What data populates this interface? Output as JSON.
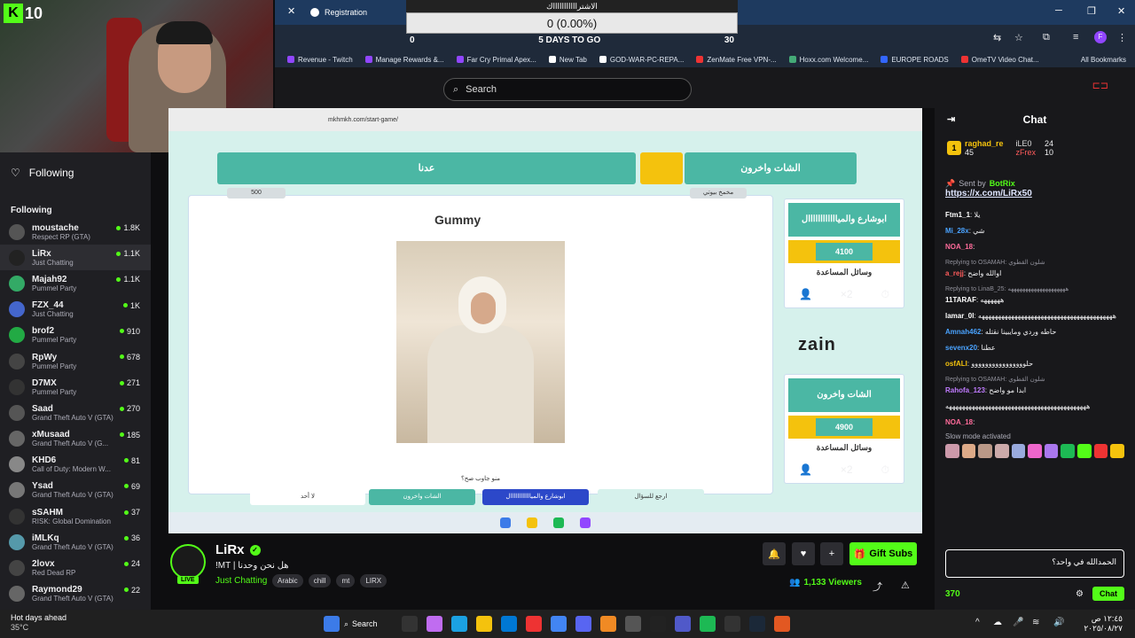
{
  "browser": {
    "tabs": [
      {
        "label": "Registration"
      }
    ],
    "bookmarks": [
      {
        "label": "Revenue - Twitch",
        "color": "#9146ff"
      },
      {
        "label": "Manage Rewards &...",
        "color": "#9146ff"
      },
      {
        "label": "Far Cry Primal Apex...",
        "color": "#9146ff"
      },
      {
        "label": "New Tab",
        "color": "#fff"
      },
      {
        "label": "GOD-WAR-PC-REPA...",
        "color": "#fff"
      },
      {
        "label": "ZenMate Free VPN-...",
        "color": "#e33"
      },
      {
        "label": "Hoxx.com Welcome...",
        "color": "#4a7"
      },
      {
        "label": "EUROPE ROADS",
        "color": "#36f"
      },
      {
        "label": "OmeTV Video Chat...",
        "color": "#e33"
      }
    ],
    "all_bookmarks": "All Bookmarks",
    "url": "mkhmkh.com/start-game/"
  },
  "goal": {
    "title": "الاشتراااااااااااك",
    "value_text": "0 (0.00%)",
    "progress": 0,
    "start": "0",
    "end": "30",
    "days": "5 DAYS TO GO"
  },
  "webcam": {
    "badge": "K",
    "count": "10"
  },
  "search": {
    "placeholder": "Search"
  },
  "sidebar": {
    "following_header": "Following",
    "section_label": "Following",
    "items": [
      {
        "name": "moustache",
        "category": "Respect RP (GTA)",
        "viewers": "1.8K",
        "color": "#555"
      },
      {
        "name": "LiRx",
        "category": "Just Chatting",
        "viewers": "1.1K",
        "color": "#222",
        "active": true
      },
      {
        "name": "Majah92",
        "category": "Pummel Party",
        "viewers": "1.1K",
        "color": "#3a6"
      },
      {
        "name": "FZX_44",
        "category": "Just Chatting",
        "viewers": "1K",
        "color": "#46c"
      },
      {
        "name": "brof2",
        "category": "Pummel Party",
        "viewers": "910",
        "color": "#2a4"
      },
      {
        "name": "RpWy",
        "category": "Pummel Party",
        "viewers": "678",
        "color": "#444"
      },
      {
        "name": "D7MX",
        "category": "Pummel Party",
        "viewers": "271",
        "color": "#333"
      },
      {
        "name": "Saad",
        "category": "Grand Theft Auto V (GTA)",
        "viewers": "270",
        "color": "#555"
      },
      {
        "name": "xMusaad",
        "category": "Grand Theft Auto V (G...",
        "viewers": "185",
        "color": "#666"
      },
      {
        "name": "KHD6",
        "category": "Call of Duty: Modern W...",
        "viewers": "81",
        "color": "#888"
      },
      {
        "name": "Ysad",
        "category": "Grand Theft Auto V (GTA)",
        "viewers": "69",
        "color": "#777"
      },
      {
        "name": "sSAHM",
        "category": "RISK: Global Domination",
        "viewers": "37",
        "color": "#333"
      },
      {
        "name": "iMLKq",
        "category": "Grand Theft Auto V (GTA)",
        "viewers": "36",
        "color": "#59a"
      },
      {
        "name": "2lovx",
        "category": "Red Dead RP",
        "viewers": "24",
        "color": "#444"
      },
      {
        "name": "Raymond29",
        "category": "Grand Theft Auto V (GTA)",
        "viewers": "22",
        "color": "#666"
      }
    ]
  },
  "game": {
    "team_left": "عدنا",
    "team_right": "الشات واخرون",
    "left_score_pill": "500",
    "right_name_pill": "مخمخ بيوتي",
    "question_title": "Gummy",
    "question_text": "منو جاوب صح؟",
    "card1": {
      "title": "ابوشارع والمياااااااااااال",
      "score": "4100",
      "help": "وسائل المساعدة"
    },
    "card2": {
      "title": "الشات واخرون",
      "score": "4900",
      "help": "وسائل المساعدة"
    },
    "sponsor": "zain",
    "bottom_buttons": [
      {
        "label": "لا أحد",
        "color": "#fff",
        "text": "#333"
      },
      {
        "label": "الشات واخرون",
        "color": "#4bb7a4",
        "text": "#fff"
      },
      {
        "label": "ابوشارع والمياااااااااااال",
        "color": "#2c48c9",
        "text": "#fff"
      },
      {
        "label": "ارجع للسؤال",
        "color": "#d6f1ec",
        "text": "#333"
      }
    ]
  },
  "stream": {
    "channel": "LiRx",
    "title": "!MT | هل نحن وحدنا",
    "category": "Just Chatting",
    "tags": [
      "Arabic",
      "chill",
      "mt",
      "LIRX"
    ],
    "viewers": "1,133 Viewers",
    "gift_label": "Gift Subs",
    "live_label": "LIVE"
  },
  "chat": {
    "title": "Chat",
    "leaders": [
      {
        "rank": "1",
        "name": "raghad_re",
        "count": "45"
      },
      {
        "name": "iLE0",
        "count": "24"
      },
      {
        "name": "zFrex",
        "count": "10"
      }
    ],
    "pinned_by": "Sent by",
    "pinned_user": "BotRix",
    "pinned_link": "https://x.com/LiRx50",
    "messages": [
      {
        "user": "Ftm1_1",
        "text": "يلا",
        "color": "#fff"
      },
      {
        "user": "Mi_28x",
        "text": "شي",
        "color": "#4aa3ff"
      },
      {
        "user": "NOA_18",
        "text": "",
        "color": "#ff6b9a"
      },
      {
        "reply": "Replying to OSAMAH: شلون القطوي",
        "user": "a_rejj",
        "text": "اوالله واضح",
        "color": "#ff5c5c"
      },
      {
        "reply": "Replying to LinaB_25: ههههههههههههههههههههه",
        "user": "11TARAF",
        "text": "ههههههه",
        "color": "#fff"
      },
      {
        "user": "lamar_0l",
        "text": "هههههههههههههههههههههههههههههههههههههههههه",
        "color": "#fff"
      },
      {
        "user": "Amnah462",
        "text": "حاطه وردي ومايبينا نقتله",
        "color": "#4aa3ff"
      },
      {
        "user": "sevenx20",
        "text": "عطنا",
        "color": "#4aa3ff"
      },
      {
        "user": "osfALI",
        "text": "حلوووووووووووووووو",
        "color": "#f4c20d"
      },
      {
        "reply": "Replying to OSAMAH: شلون القطوي",
        "user": "Rahofa_123",
        "text": "ابدا مو واضح",
        "color": "#c07bff"
      },
      {
        "user": "",
        "text": "هههههههههههههههههههههههههههههههههههههههههههه",
        "color": "#fff"
      },
      {
        "user": "NOA_18",
        "text": "",
        "color": "#ff6b9a"
      }
    ],
    "slow_mode": "Slow mode activated",
    "input_value": "الحمدالله في واحد؟",
    "points": "370",
    "send_label": "Chat"
  },
  "taskbar": {
    "weather_title": "Hot days ahead",
    "weather_temp": "35°C",
    "search_label": "Search",
    "time": "١٢:٤٥ ص",
    "date": "٢٠٢٥/٠٨/٢٧"
  }
}
